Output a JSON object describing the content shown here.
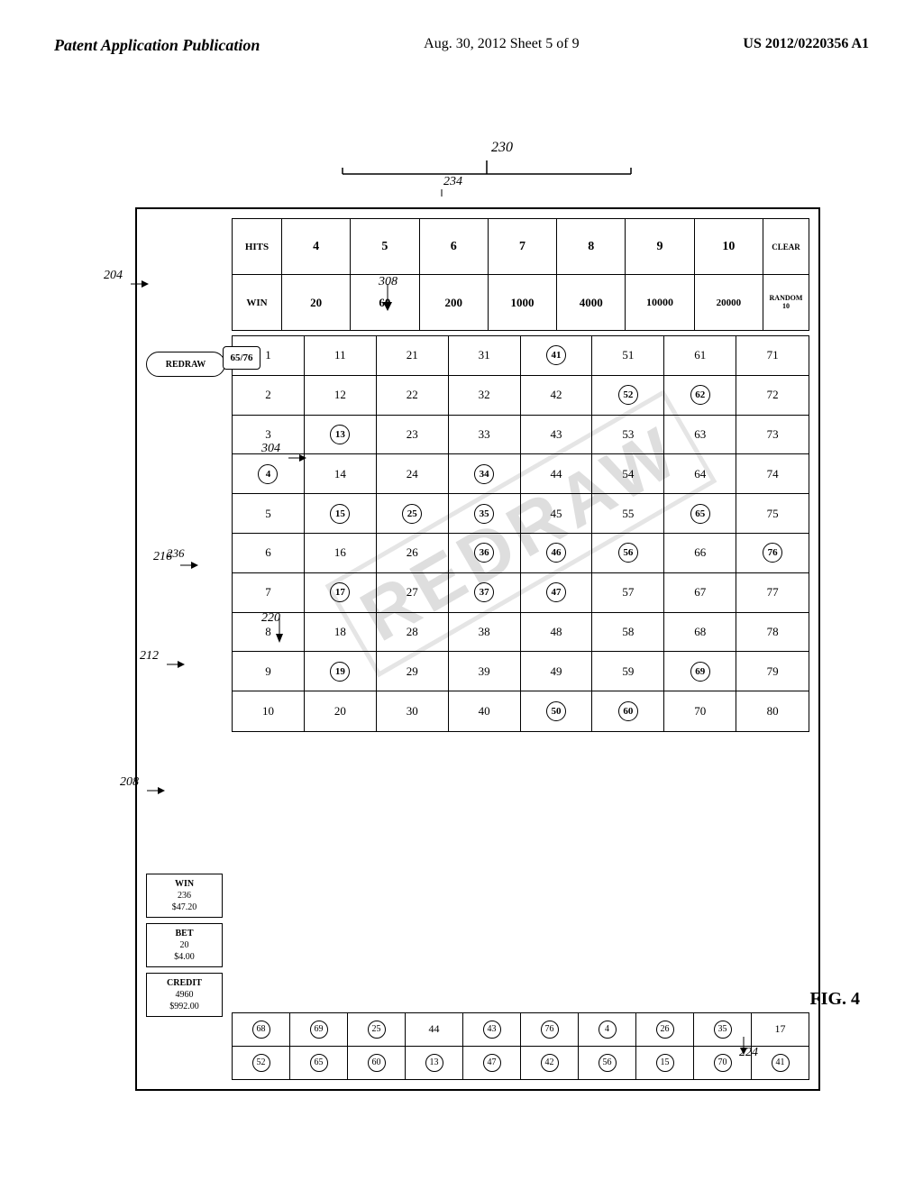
{
  "header": {
    "left": "Patent Application Publication",
    "center": "Aug. 30, 2012    Sheet 5 of 9",
    "right": "US 2012/0220356 A1"
  },
  "figure": {
    "label": "FIG. 4",
    "ref_numbers": {
      "r230": "230",
      "r234": "234",
      "r204": "204",
      "r308": "308",
      "r304": "304",
      "r216": "216",
      "r212": "212",
      "r208": "208",
      "r220": "220",
      "r224": "224",
      "r236": "236"
    }
  },
  "pay_table": {
    "header_row": [
      "HITS",
      "WIN",
      "4",
      "20",
      "5",
      "60",
      "6",
      "200",
      "7",
      "1000",
      "8",
      "4000",
      "9",
      "10000",
      "10",
      "20000",
      "CLEAR",
      "RANDOM 10"
    ],
    "rows": [
      {
        "hits": "HITS",
        "win": "WIN"
      },
      {
        "hits": "4",
        "win": "20"
      },
      {
        "hits": "5",
        "win": "60"
      },
      {
        "hits": "6",
        "win": "200"
      },
      {
        "hits": "7",
        "win": "1000"
      },
      {
        "hits": "8",
        "win": "4000"
      },
      {
        "hits": "9",
        "win": "10000"
      },
      {
        "hits": "10",
        "win": "20000"
      }
    ]
  },
  "keno_numbers": [
    1,
    2,
    3,
    4,
    5,
    6,
    7,
    8,
    9,
    10,
    11,
    12,
    13,
    14,
    15,
    16,
    17,
    18,
    19,
    20,
    21,
    22,
    23,
    24,
    25,
    26,
    27,
    28,
    29,
    30,
    31,
    32,
    33,
    34,
    35,
    36,
    37,
    38,
    39,
    40,
    41,
    42,
    43,
    44,
    45,
    46,
    47,
    48,
    49,
    50,
    51,
    52,
    53,
    54,
    55,
    56,
    57,
    58,
    59,
    60,
    61,
    62,
    63,
    64,
    65,
    66,
    67,
    68,
    69,
    70,
    71,
    72,
    73,
    74,
    75,
    76,
    77,
    78,
    79,
    80
  ],
  "circled_numbers": [
    4,
    13,
    15,
    17,
    19,
    25,
    34,
    35,
    36,
    37,
    41,
    46,
    47,
    50,
    52,
    56,
    60,
    62,
    65,
    69,
    76
  ],
  "selected_numbers_row1": [
    68,
    69,
    25,
    44,
    43,
    76,
    4,
    26,
    35,
    17
  ],
  "selected_numbers_row2": [
    52,
    65,
    60,
    13,
    47,
    42,
    56,
    15,
    70,
    41
  ],
  "circled_selected": [
    68,
    69,
    25,
    43,
    76,
    4,
    26,
    35,
    52,
    65,
    60,
    13,
    47,
    42,
    56,
    15,
    70,
    41
  ],
  "info_blocks": {
    "credit": {
      "label": "CREDIT",
      "value1": "4960",
      "value2": "$992.00"
    },
    "bet": {
      "label": "BET",
      "value1": "20",
      "value2": "$4.00"
    },
    "win": {
      "label": "WIN",
      "value1": "236",
      "value2": "$47.20"
    }
  },
  "redraw_button": "REDRAW",
  "redraw_badge": "65/76"
}
